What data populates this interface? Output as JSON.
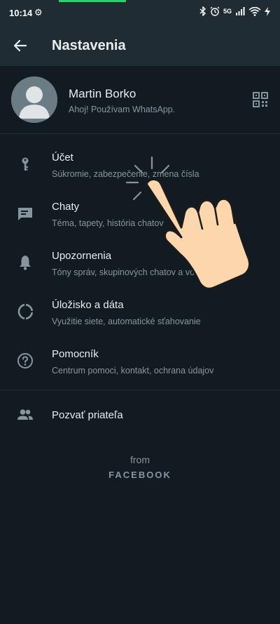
{
  "status_bar": {
    "time": "10:14",
    "network": "5G",
    "icons": [
      "settings-gear-icon",
      "bluetooth-icon",
      "alarm-icon",
      "signal-icon",
      "wifi-icon",
      "charging-icon"
    ]
  },
  "app_bar": {
    "title": "Nastavenia",
    "back_icon": "arrow-left-icon"
  },
  "profile": {
    "name": "Martin Borko",
    "status": "Ahoj! Používam WhatsApp.",
    "qr_icon": "qr-code-icon"
  },
  "settings": [
    {
      "title": "Účet",
      "subtitle": "Súkromie, zabezpečenie, zmena čísla",
      "icon": "key-icon"
    },
    {
      "title": "Chaty",
      "subtitle": "Téma, tapety, história chatov",
      "icon": "chat-icon"
    },
    {
      "title": "Upozornenia",
      "subtitle": "Tóny správ, skupinových chatov a volaní",
      "icon": "bell-icon"
    },
    {
      "title": "Úložisko a dáta",
      "subtitle": "Využitie siete, automatické sťahovanie",
      "icon": "storage-icon"
    },
    {
      "title": "Pomocník",
      "subtitle": "Centrum pomoci, kontakt, ochrana údajov",
      "icon": "help-icon"
    }
  ],
  "invite": {
    "title": "Pozvať priateľa",
    "icon": "people-icon"
  },
  "footer": {
    "from": "from",
    "brand": "FACEBOOK"
  },
  "colors": {
    "background": "#121b22",
    "app_bar": "#1f2c34",
    "primary_text": "#e9edef",
    "secondary_text": "#8696a0",
    "icon": "#8696a0",
    "accent": "#25d366"
  }
}
